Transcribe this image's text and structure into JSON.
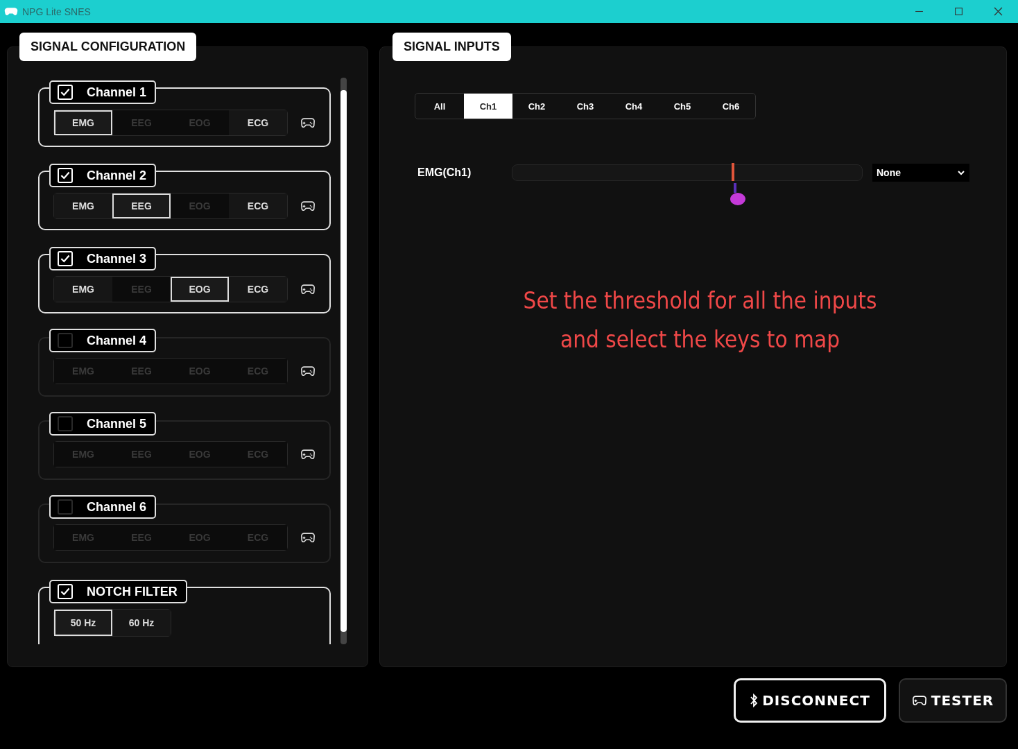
{
  "window": {
    "title": "NPG Lite SNES"
  },
  "signal_configuration": {
    "title": "SIGNAL CONFIGURATION",
    "channels": [
      {
        "label": "Channel 1",
        "checked": true,
        "modes": [
          {
            "label": "EMG",
            "selected": true,
            "disabled": false
          },
          {
            "label": "EEG",
            "selected": false,
            "disabled": true
          },
          {
            "label": "EOG",
            "selected": false,
            "disabled": true
          },
          {
            "label": "ECG",
            "selected": false,
            "disabled": false
          }
        ]
      },
      {
        "label": "Channel 2",
        "checked": true,
        "modes": [
          {
            "label": "EMG",
            "selected": false,
            "disabled": false
          },
          {
            "label": "EEG",
            "selected": true,
            "disabled": false
          },
          {
            "label": "EOG",
            "selected": false,
            "disabled": true
          },
          {
            "label": "ECG",
            "selected": false,
            "disabled": false
          }
        ]
      },
      {
        "label": "Channel 3",
        "checked": true,
        "modes": [
          {
            "label": "EMG",
            "selected": false,
            "disabled": false
          },
          {
            "label": "EEG",
            "selected": false,
            "disabled": true
          },
          {
            "label": "EOG",
            "selected": true,
            "disabled": false
          },
          {
            "label": "ECG",
            "selected": false,
            "disabled": false
          }
        ]
      },
      {
        "label": "Channel 4",
        "checked": false,
        "modes": [
          {
            "label": "EMG",
            "selected": false,
            "disabled": true
          },
          {
            "label": "EEG",
            "selected": false,
            "disabled": true
          },
          {
            "label": "EOG",
            "selected": false,
            "disabled": true
          },
          {
            "label": "ECG",
            "selected": false,
            "disabled": true
          }
        ]
      },
      {
        "label": "Channel 5",
        "checked": false,
        "modes": [
          {
            "label": "EMG",
            "selected": false,
            "disabled": true
          },
          {
            "label": "EEG",
            "selected": false,
            "disabled": true
          },
          {
            "label": "EOG",
            "selected": false,
            "disabled": true
          },
          {
            "label": "ECG",
            "selected": false,
            "disabled": true
          }
        ]
      },
      {
        "label": "Channel 6",
        "checked": false,
        "modes": [
          {
            "label": "EMG",
            "selected": false,
            "disabled": true
          },
          {
            "label": "EEG",
            "selected": false,
            "disabled": true
          },
          {
            "label": "EOG",
            "selected": false,
            "disabled": true
          },
          {
            "label": "ECG",
            "selected": false,
            "disabled": true
          }
        ]
      }
    ],
    "notch_filter": {
      "label": "NOTCH FILTER",
      "checked": true,
      "options": [
        {
          "label": "50 Hz",
          "selected": true
        },
        {
          "label": "60 Hz",
          "selected": false
        }
      ]
    }
  },
  "signal_inputs": {
    "title": "SIGNAL INPUTS",
    "tabs": [
      {
        "label": "All",
        "selected": false
      },
      {
        "label": "Ch1",
        "selected": true
      },
      {
        "label": "Ch2",
        "selected": false
      },
      {
        "label": "Ch3",
        "selected": false
      },
      {
        "label": "Ch4",
        "selected": false
      },
      {
        "label": "Ch5",
        "selected": false
      },
      {
        "label": "Ch6",
        "selected": false
      }
    ],
    "inputs": [
      {
        "label": "EMG(Ch1)",
        "level": 0.63,
        "key": "None"
      }
    ],
    "instruction": [
      "Set the threshold for all the inputs",
      "and select the keys to map"
    ]
  },
  "buttons": [
    {
      "label": "DISCONNECT",
      "kind": "bluetooth"
    },
    {
      "label": "TESTER",
      "kind": "gamepad"
    }
  ]
}
